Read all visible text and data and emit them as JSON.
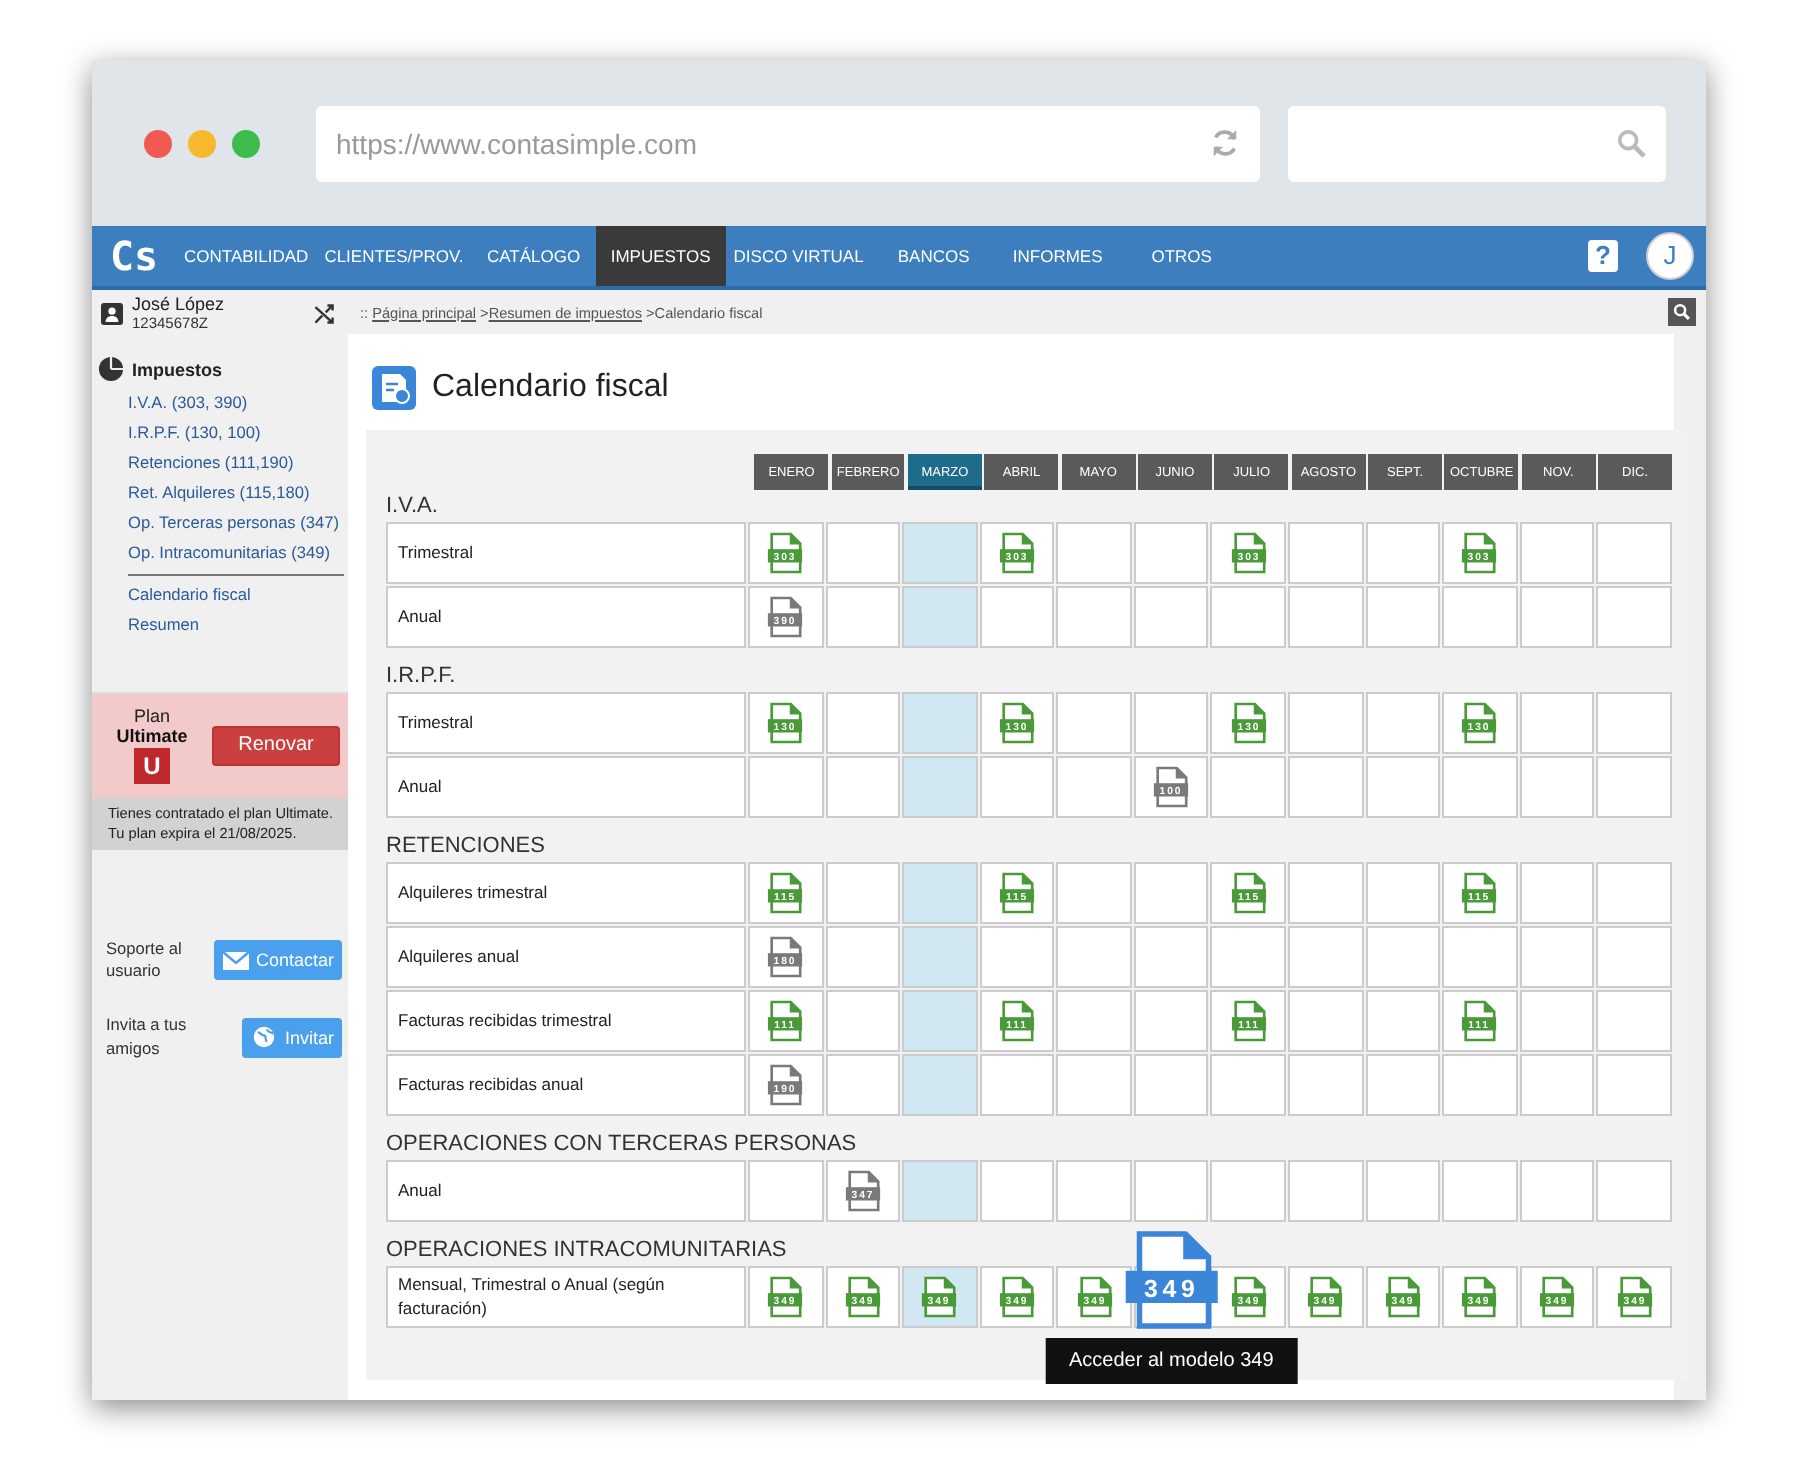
{
  "browser": {
    "url": "https://www.contasimple.com"
  },
  "nav": {
    "logo": "Cs",
    "items": [
      {
        "label": "CONTABILIDAD",
        "selected": false
      },
      {
        "label": "CLIENTES/PROV.",
        "selected": false
      },
      {
        "label": "CATÁLOGO",
        "selected": false
      },
      {
        "label": "IMPUESTOS",
        "selected": true
      },
      {
        "label": "DISCO VIRTUAL",
        "selected": false
      },
      {
        "label": "BANCOS",
        "selected": false
      },
      {
        "label": "INFORMES",
        "selected": false
      },
      {
        "label": "OTROS",
        "selected": false
      }
    ],
    "help": "?",
    "avatar": "J"
  },
  "user": {
    "name": "José López",
    "id": "12345678Z"
  },
  "breadcrumb": {
    "prefix": "::",
    "links": [
      "Página principal",
      "Resumen de impuestos"
    ],
    "separator": ">",
    "current": "Calendario fiscal"
  },
  "sidebar": {
    "title": "Impuestos",
    "items": [
      "I.V.A. (303, 390)",
      "I.R.P.F. (130, 100)",
      "Retenciones (111,190)",
      "Ret. Alquileres (115,180)",
      "Op. Terceras personas (347)",
      "Op. Intracomunitarias (349)"
    ],
    "items_after": [
      "Calendario fiscal",
      "Resumen"
    ]
  },
  "plan": {
    "label": "Plan",
    "name": "Ultimate",
    "badge": "U",
    "button": "Renovar",
    "info": "Tienes contratado el plan Ultimate. Tu plan expira el 21/08/2025."
  },
  "support": [
    {
      "text": "Soporte al usuario",
      "button": "Contactar",
      "kind": "mail"
    },
    {
      "text": "Invita a tus amigos",
      "button": "Invitar",
      "kind": "globe"
    }
  ],
  "page_title": "Calendario fiscal",
  "months": [
    {
      "label": "ENERO",
      "selected": false
    },
    {
      "label": "FEBRERO",
      "selected": false
    },
    {
      "label": "MARZO",
      "selected": true
    },
    {
      "label": "ABRIL",
      "selected": false
    },
    {
      "label": "MAYO",
      "selected": false
    },
    {
      "label": "JUNIO",
      "selected": false
    },
    {
      "label": "JULIO",
      "selected": false
    },
    {
      "label": "AGOSTO",
      "selected": false
    },
    {
      "label": "SEPT.",
      "selected": false
    },
    {
      "label": "OCTUBRE",
      "selected": false
    },
    {
      "label": "NOV.",
      "selected": false
    },
    {
      "label": "DIC.",
      "selected": false
    }
  ],
  "sections": [
    {
      "title": "I.V.A.",
      "rows": [
        {
          "label": "Trimestral",
          "cells": [
            {
              "model": "303",
              "active": true
            },
            {},
            {},
            {
              "model": "303",
              "active": true
            },
            {},
            {},
            {
              "model": "303",
              "active": true
            },
            {},
            {},
            {
              "model": "303",
              "active": true
            },
            {},
            {}
          ]
        },
        {
          "label": "Anual",
          "cells": [
            {
              "model": "390",
              "active": false
            },
            {},
            {},
            {},
            {},
            {},
            {},
            {},
            {},
            {},
            {},
            {}
          ]
        }
      ]
    },
    {
      "title": "I.R.P.F.",
      "rows": [
        {
          "label": "Trimestral",
          "cells": [
            {
              "model": "130",
              "active": true
            },
            {},
            {},
            {
              "model": "130",
              "active": true
            },
            {},
            {},
            {
              "model": "130",
              "active": true
            },
            {},
            {},
            {
              "model": "130",
              "active": true
            },
            {},
            {}
          ]
        },
        {
          "label": "Anual",
          "cells": [
            {},
            {},
            {},
            {},
            {},
            {
              "model": "100",
              "active": false
            },
            {},
            {},
            {},
            {},
            {},
            {}
          ]
        }
      ]
    },
    {
      "title": "RETENCIONES",
      "rows": [
        {
          "label": "Alquileres trimestral",
          "cells": [
            {
              "model": "115",
              "active": true
            },
            {},
            {},
            {
              "model": "115",
              "active": true
            },
            {},
            {},
            {
              "model": "115",
              "active": true
            },
            {},
            {},
            {
              "model": "115",
              "active": true
            },
            {},
            {}
          ]
        },
        {
          "label": "Alquileres anual",
          "cells": [
            {
              "model": "180",
              "active": false
            },
            {},
            {},
            {},
            {},
            {},
            {},
            {},
            {},
            {},
            {},
            {}
          ]
        },
        {
          "label": "Facturas recibidas trimestral",
          "cells": [
            {
              "model": "111",
              "active": true
            },
            {},
            {},
            {
              "model": "111",
              "active": true
            },
            {},
            {},
            {
              "model": "111",
              "active": true
            },
            {},
            {},
            {
              "model": "111",
              "active": true
            },
            {},
            {}
          ]
        },
        {
          "label": "Facturas recibidas anual",
          "cells": [
            {
              "model": "190",
              "active": false
            },
            {},
            {},
            {},
            {},
            {},
            {},
            {},
            {},
            {},
            {},
            {}
          ]
        }
      ]
    },
    {
      "title": "OPERACIONES CON TERCERAS PERSONAS",
      "rows": [
        {
          "label": "Anual",
          "cells": [
            {},
            {
              "model": "347",
              "active": false
            },
            {},
            {},
            {},
            {},
            {},
            {},
            {},
            {},
            {},
            {}
          ]
        }
      ]
    },
    {
      "title": "OPERACIONES INTRACOMUNITARIAS",
      "rows": [
        {
          "label": "Mensual, Trimestral o Anual (según facturación)",
          "cells": [
            {
              "model": "349",
              "active": true
            },
            {
              "model": "349",
              "active": true
            },
            {
              "model": "349",
              "active": true
            },
            {
              "model": "349",
              "active": true
            },
            {
              "model": "349",
              "active": true
            },
            {
              "model": "349",
              "active": true,
              "hovered": true,
              "tooltip": "Acceder al modelo 349"
            },
            {
              "model": "349",
              "active": true
            },
            {
              "model": "349",
              "active": true
            },
            {
              "model": "349",
              "active": true
            },
            {
              "model": "349",
              "active": true
            },
            {
              "model": "349",
              "active": true
            },
            {
              "model": "349",
              "active": true
            }
          ]
        }
      ]
    }
  ]
}
